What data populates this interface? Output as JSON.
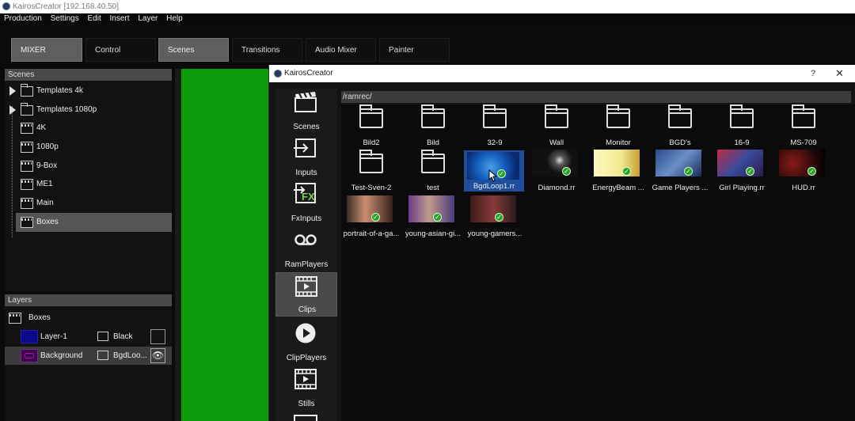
{
  "window": {
    "title": "KairosCreator [192.168.40.50]"
  },
  "menu": [
    "Production",
    "Settings",
    "Edit",
    "Insert",
    "Layer",
    "Help"
  ],
  "toolbar_tabs": [
    "MIXER",
    "Control",
    "Scenes",
    "Transitions",
    "Audio Mixer",
    "Painter"
  ],
  "scenes_panel": {
    "title": "Scenes",
    "items": [
      "Templates 4k",
      "Templates 1080p",
      "4K",
      "1080p",
      "9-Box",
      "ME1",
      "Main",
      "Boxes"
    ]
  },
  "layers_panel": {
    "title": "Layers",
    "scene": "Boxes",
    "layers": [
      {
        "name": "Layer-1",
        "source": "Black"
      },
      {
        "name": "Background",
        "source": "BgdLoo..."
      }
    ]
  },
  "dialog": {
    "title": "KairosCreator",
    "help": "?",
    "close": "✕",
    "path": "/ramrec/",
    "sidebar": [
      "Scenes",
      "Inputs",
      "FxInputs",
      "RamPlayers",
      "Clips",
      "ClipPlayers",
      "Stills"
    ],
    "fx_badge": "FX",
    "folders": [
      "Bild2",
      "Bild",
      "32-9",
      "Wall",
      "Monitor",
      "BGD's",
      "16-9",
      "MS-709",
      "Test-Sven-2",
      "test"
    ],
    "clips": [
      "BgdLoop1.rr",
      "Diamond.rr",
      "EnergyBeam ...",
      "Game Players ...",
      "Girl Playing.rr",
      "HUD.rr",
      "portrait-of-a-ga...",
      "young-asian-gi...",
      "young-gamers..."
    ]
  },
  "colors": {
    "green_preview": "#0a9a0a",
    "selected_clip": "#1f4f9a",
    "badge_green": "#2aa02a"
  }
}
